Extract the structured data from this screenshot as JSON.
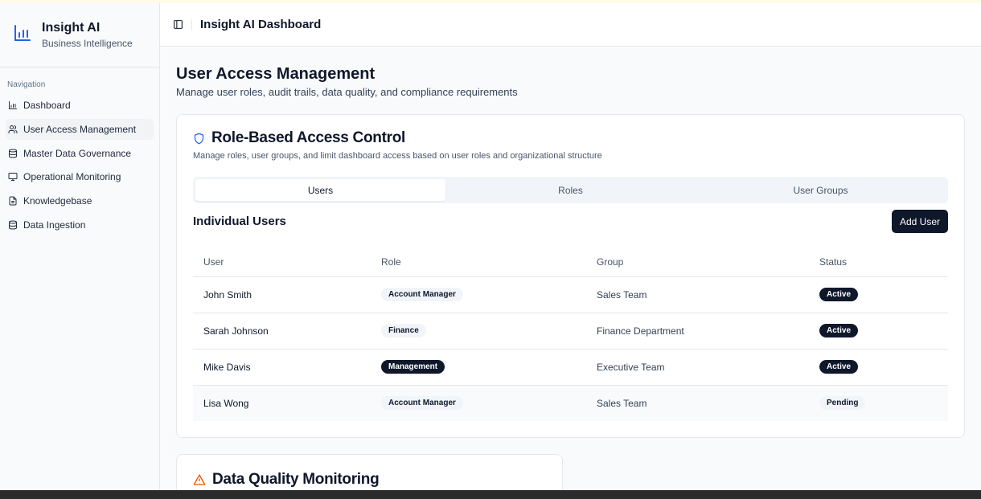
{
  "brand": {
    "title": "Insight AI",
    "subtitle": "Business Intelligence"
  },
  "nav": {
    "label": "Navigation",
    "items": [
      {
        "label": "Dashboard",
        "icon": "bar-chart-icon"
      },
      {
        "label": "User Access Management",
        "icon": "users-icon",
        "active": true
      },
      {
        "label": "Master Data Governance",
        "icon": "database-icon"
      },
      {
        "label": "Operational Monitoring",
        "icon": "monitor-icon"
      },
      {
        "label": "Knowledgebase",
        "icon": "file-text-icon"
      },
      {
        "label": "Data Ingestion",
        "icon": "database-icon"
      }
    ]
  },
  "header": {
    "title": "Insight AI Dashboard"
  },
  "page": {
    "title": "User Access Management",
    "subtitle": "Manage user roles, audit trails, data quality, and compliance requirements"
  },
  "rbac": {
    "title": "Role-Based Access Control",
    "description": "Manage roles, user groups, and limit dashboard access based on user roles and organizational structure",
    "tabs": [
      "Users",
      "Roles",
      "User Groups"
    ],
    "section_title": "Individual Users",
    "add_button": "Add User",
    "columns": [
      "User",
      "Role",
      "Group",
      "Status"
    ],
    "rows": [
      {
        "user": "John Smith",
        "role": "Account Manager",
        "group": "Sales Team",
        "status": "Active"
      },
      {
        "user": "Sarah Johnson",
        "role": "Finance",
        "group": "Finance Department",
        "status": "Active"
      },
      {
        "user": "Mike Davis",
        "role": "Management",
        "group": "Executive Team",
        "status": "Active"
      },
      {
        "user": "Lisa Wong",
        "role": "Account Manager",
        "group": "Sales Team",
        "status": "Pending"
      }
    ]
  },
  "data_quality": {
    "title": "Data Quality Monitoring"
  },
  "colors": {
    "accent": "#2563eb",
    "dark": "#0f172a",
    "warning": "#ea580c"
  }
}
